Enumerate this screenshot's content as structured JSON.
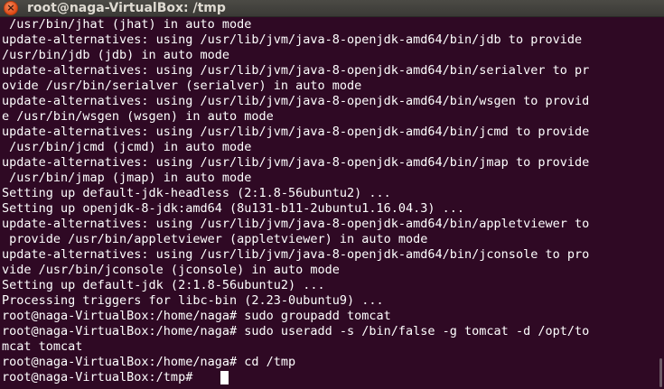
{
  "window": {
    "title": "root@naga-VirtualBox: /tmp",
    "close_glyph": "×"
  },
  "terminal": {
    "lines": [
      " /usr/bin/jhat (jhat) in auto mode",
      "update-alternatives: using /usr/lib/jvm/java-8-openjdk-amd64/bin/jdb to provide",
      "/usr/bin/jdb (jdb) in auto mode",
      "update-alternatives: using /usr/lib/jvm/java-8-openjdk-amd64/bin/serialver to pr",
      "ovide /usr/bin/serialver (serialver) in auto mode",
      "update-alternatives: using /usr/lib/jvm/java-8-openjdk-amd64/bin/wsgen to provid",
      "e /usr/bin/wsgen (wsgen) in auto mode",
      "update-alternatives: using /usr/lib/jvm/java-8-openjdk-amd64/bin/jcmd to provide",
      " /usr/bin/jcmd (jcmd) in auto mode",
      "update-alternatives: using /usr/lib/jvm/java-8-openjdk-amd64/bin/jmap to provide",
      " /usr/bin/jmap (jmap) in auto mode",
      "Setting up default-jdk-headless (2:1.8-56ubuntu2) ...",
      "Setting up openjdk-8-jdk:amd64 (8u131-b11-2ubuntu1.16.04.3) ...",
      "update-alternatives: using /usr/lib/jvm/java-8-openjdk-amd64/bin/appletviewer to",
      " provide /usr/bin/appletviewer (appletviewer) in auto mode",
      "update-alternatives: using /usr/lib/jvm/java-8-openjdk-amd64/bin/jconsole to pro",
      "vide /usr/bin/jconsole (jconsole) in auto mode",
      "Setting up default-jdk (2:1.8-56ubuntu2) ...",
      "Processing triggers for libc-bin (2.23-0ubuntu9) ...",
      "root@naga-VirtualBox:/home/naga# sudo groupadd tomcat",
      "root@naga-VirtualBox:/home/naga# sudo useradd -s /bin/false -g tomcat -d /opt/to",
      "mcat tomcat",
      "root@naga-VirtualBox:/home/naga# cd /tmp",
      "root@naga-VirtualBox:/tmp# "
    ]
  },
  "colors": {
    "background": "#2f0924",
    "text": "#ffffff",
    "titlebar": "#3b3a36",
    "close_button": "#df4a16"
  }
}
